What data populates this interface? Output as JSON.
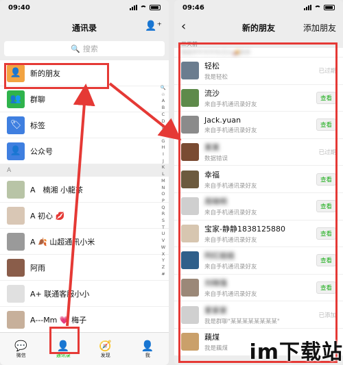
{
  "left": {
    "status": {
      "time": "09:40"
    },
    "title": "通讯录",
    "search_placeholder": "搜索",
    "shortcuts": [
      {
        "label": "新的朋友",
        "color": "#f2a341",
        "glyph": "person-plus-icon"
      },
      {
        "label": "群聊",
        "color": "#2fb34c",
        "glyph": "group-icon"
      },
      {
        "label": "标签",
        "color": "#3f7fe0",
        "glyph": "tag-icon"
      },
      {
        "label": "公众号",
        "color": "#3f7fe0",
        "glyph": "official-account-icon"
      }
    ],
    "section": "A",
    "contacts": [
      {
        "name": "A　楠湘 小龍茶"
      },
      {
        "name": "A 初心 💋"
      },
      {
        "name": "A 🍂 山超通讯小米"
      },
      {
        "name": "阿雨"
      },
      {
        "name": "A+ 联通客服小小"
      },
      {
        "name": "A---Mm 💗 梅子"
      }
    ],
    "alphabet": [
      "🔍",
      "☆",
      "A",
      "B",
      "C",
      "D",
      "E",
      "F",
      "G",
      "H",
      "I",
      "J",
      "K",
      "L",
      "M",
      "N",
      "O",
      "P",
      "Q",
      "R",
      "S",
      "T",
      "U",
      "V",
      "W",
      "X",
      "Y",
      "Z",
      "#"
    ],
    "tabs": [
      {
        "label": "微信",
        "icon": "chat-icon"
      },
      {
        "label": "通讯录",
        "icon": "contacts-icon"
      },
      {
        "label": "发现",
        "icon": "compass-icon"
      },
      {
        "label": "我",
        "icon": "me-icon"
      }
    ]
  },
  "right": {
    "status": {
      "time": "09:46"
    },
    "title": "新的朋友",
    "action": "添加朋友",
    "back": "‹",
    "section": "三天前",
    "top_cut": "我是手牛号号号(已以🚚取单",
    "friends": [
      {
        "name": "轻松",
        "sub": "我是轻松",
        "state": "已过期",
        "button": false,
        "blur": false
      },
      {
        "name": "流沙",
        "sub": "来自手机通讯录好友",
        "state": "查看",
        "button": true,
        "blur": false
      },
      {
        "name": "Jack.yuan",
        "sub": "来自手机通讯录好友",
        "state": "查看",
        "button": true,
        "blur": false
      },
      {
        "name": "某某",
        "sub": "数据错误",
        "state": "已过期",
        "button": false,
        "blur": true
      },
      {
        "name": "幸福",
        "sub": "来自手机通讯录好友",
        "state": "查看",
        "button": true,
        "blur": false
      },
      {
        "name": "周晓明",
        "sub": "来自手机通讯录好友",
        "state": "查看",
        "button": true,
        "blur": true
      },
      {
        "name": "宝家-静静1838125880",
        "sub": "来自手机通讯录好友",
        "state": "查看",
        "button": true,
        "blur": false
      },
      {
        "name": "阿红姐姐",
        "sub": "来自手机通讯录好友",
        "state": "查看",
        "button": true,
        "blur": true
      },
      {
        "name": "刘晓强",
        "sub": "来自手机通讯录好友",
        "state": "查看",
        "button": true,
        "blur": true
      },
      {
        "name": "爱家家",
        "sub": "我是群聊\"某某某某某某某某\"",
        "state": "已添加",
        "button": false,
        "blur": true
      },
      {
        "name": "藕煤",
        "sub": "我是藕煤",
        "state": "",
        "button": false,
        "blur": false
      }
    ]
  },
  "watermark": "im下载站",
  "colors": {
    "highlight": "#e53935",
    "wechat_green": "#09bb07"
  }
}
